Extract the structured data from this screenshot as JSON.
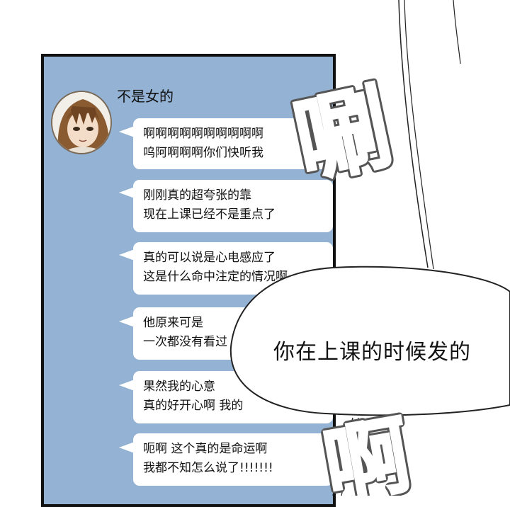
{
  "chat": {
    "sender": "不是女的",
    "messages": [
      {
        "lines": [
          "啊啊啊啊啊啊啊啊啊啊",
          "呜阿啊啊啊你们快听我"
        ]
      },
      {
        "lines": [
          "刚刚真的超夸张的靠",
          "现在上课已经不是重点了"
        ]
      },
      {
        "lines": [
          "真的可以说是心电感应了",
          "这是什么命中注定的情况啊"
        ]
      },
      {
        "lines": [
          "他原来可是",
          "一次都没有看过"
        ]
      },
      {
        "lines": [
          "果然我的心意",
          "真的好开心啊 我的"
        ]
      },
      {
        "lines": [
          "呃啊 这个真的是命运啊",
          "我都不知怎么说了!!!!!!!"
        ]
      }
    ]
  },
  "speech_bubble": {
    "text": "你在上课的时候发的"
  },
  "sfx": {
    "top": "唰",
    "bottom": "啊"
  },
  "colors": {
    "chat_background": "#94b2d4",
    "frame": "#111111",
    "bubble": "#ffffff"
  },
  "icons": {
    "avatar": "avatar-girl-brown-hair"
  }
}
